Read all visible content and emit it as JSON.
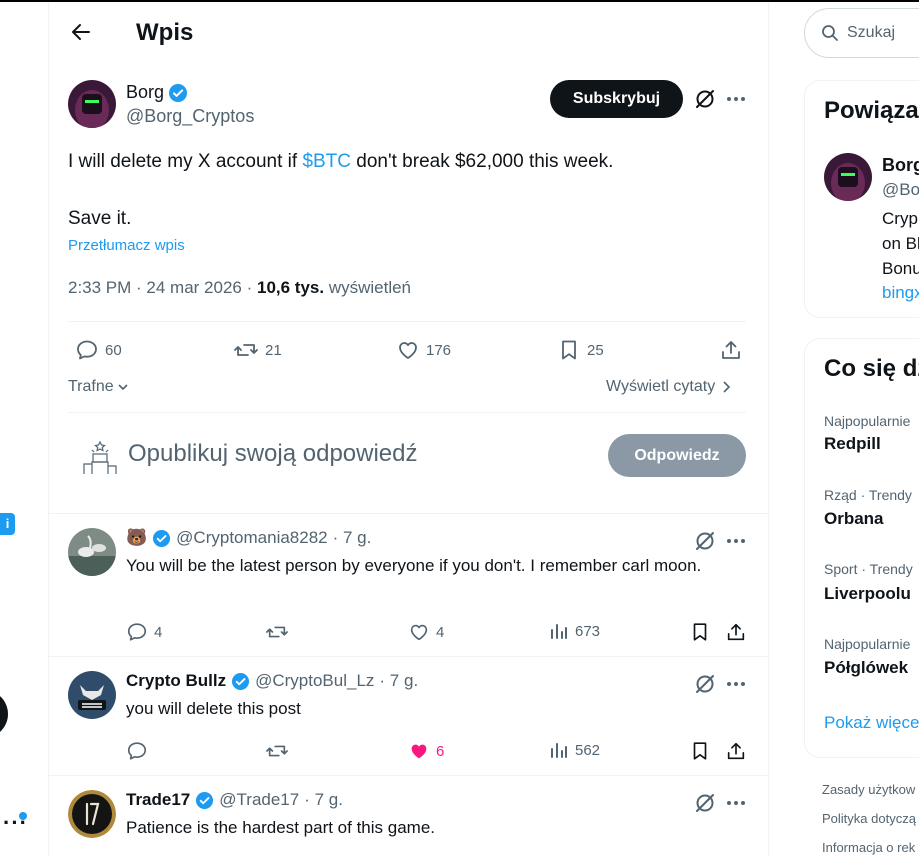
{
  "header": {
    "title": "Wpis"
  },
  "post": {
    "author_name": "Borg",
    "author_handle": "@Borg_Cryptos",
    "subscribe_label": "Subskrybuj",
    "text_before": "I will delete my X account if ",
    "cashtag": "$BTC",
    "text_after": " don't break $62,000 this week.",
    "text_line2": "Save it.",
    "translate_label": "Przetłumacz wpis",
    "time": "2:33 PM · 24 mar 2026 · ",
    "views_count": "10,6 tys.",
    "views_label": " wyświetleń",
    "replies": "60",
    "reposts": "21",
    "likes": "176",
    "bookmarks": "25"
  },
  "sort": {
    "label": "Trafne",
    "quotes_label": "Wyświetl cytaty"
  },
  "composer": {
    "placeholder": "Opublikuj swoją odpowiedź",
    "button_label": "Odpowiedz"
  },
  "replies": [
    {
      "emoji": "🐻",
      "handle": "@Cryptomania8282",
      "time": "· 7 g.",
      "text": "You will be the latest person  by everyone if you don't. I remember carl moon.",
      "replies": "4",
      "reposts": "",
      "likes": "4",
      "views": "673"
    },
    {
      "name": "Crypto Bullz",
      "handle": "@CryptoBul_Lz",
      "time": "· 7 g.",
      "text": "you will delete this post",
      "replies": "",
      "reposts": "",
      "likes": "6",
      "views": "562"
    },
    {
      "name": "Trade17",
      "handle": "@Trade17",
      "time": "· 7 g.",
      "text": "Patience is the hardest part of this game."
    }
  ],
  "sidebar": {
    "search_placeholder": "Szukaj",
    "related_title": "Powiąza",
    "related_name": "Borg",
    "related_handle": "@Bo",
    "related_lines": [
      "Cryp",
      "on Bl",
      "Bonu"
    ],
    "related_link": "bingx",
    "trends_title": "Co się dz",
    "trends": [
      {
        "context": "Najpopularnie",
        "name": "Redpill"
      },
      {
        "context": "Rząd · Trendy",
        "name": "Orbana"
      },
      {
        "context": "Sport · Trendy",
        "name": "Liverpoolu"
      },
      {
        "context": "Najpopularnie",
        "name": "Półglówek"
      }
    ],
    "show_more": "Pokaż więce",
    "footer": [
      "Zasady użytkow",
      "Polityka dotyczą",
      "Informacja o rek"
    ]
  },
  "colors": {
    "accent": "#1d9bf0",
    "like_active": "#f91880",
    "text": "#0f1419",
    "muted": "#536471"
  }
}
